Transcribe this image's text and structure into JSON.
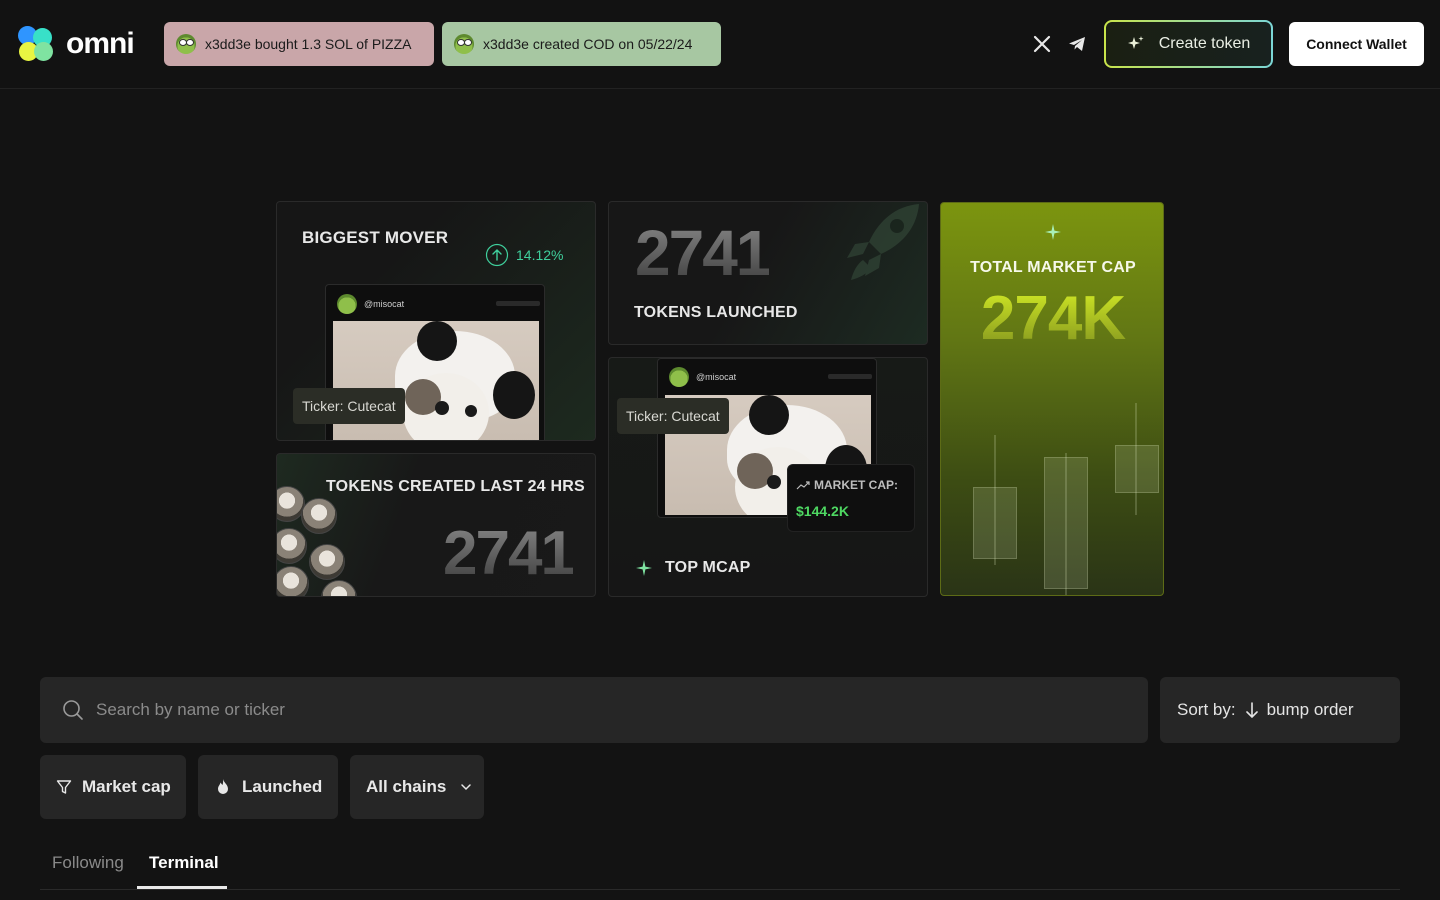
{
  "brand": {
    "name": "omni"
  },
  "header": {
    "tickers": [
      {
        "text": "x3dd3e bought 1.3 SOL of PIZZA",
        "color": "#c9a6a9"
      },
      {
        "text": "x3dd3e created COD on 05/22/24",
        "color": "#a7c7a2"
      }
    ],
    "social": {
      "x_icon": "x-icon",
      "telegram_icon": "telegram-icon"
    },
    "create_token_label": "Create token",
    "connect_wallet_label": "Connect Wallet"
  },
  "cards": {
    "biggest_mover": {
      "title": "BIGGEST MOVER",
      "change": "14.12%",
      "post_handle": "@misocat",
      "ticker_label": "Ticker: Cutecat"
    },
    "tokens_launched": {
      "value": "2741",
      "label": "TOKENS LAUNCHED"
    },
    "tokens_created_24h": {
      "label": "TOKENS CREATED LAST 24 HRS",
      "value": "2741"
    },
    "top_mcap": {
      "post_handle": "@misocat",
      "ticker_label": "Ticker: Cutecat",
      "market_cap_label": "MARKET CAP:",
      "market_cap_value": "$144.2K",
      "label": "TOP MCAP"
    },
    "total_market_cap": {
      "label": "TOTAL MARKET CAP",
      "value": "274K"
    }
  },
  "search": {
    "placeholder": "Search by name or ticker"
  },
  "sort": {
    "label": "Sort by:",
    "value": "bump order"
  },
  "filters": {
    "market_cap": "Market cap",
    "launched": "Launched",
    "chains": "All chains"
  },
  "tabs": [
    {
      "label": "Following",
      "active": false
    },
    {
      "label": "Terminal",
      "active": true
    }
  ],
  "colors": {
    "accent_lime": "#c9e44a",
    "accent_teal": "#7bd6d6",
    "positive_green": "#4ed862",
    "background": "#131313"
  }
}
